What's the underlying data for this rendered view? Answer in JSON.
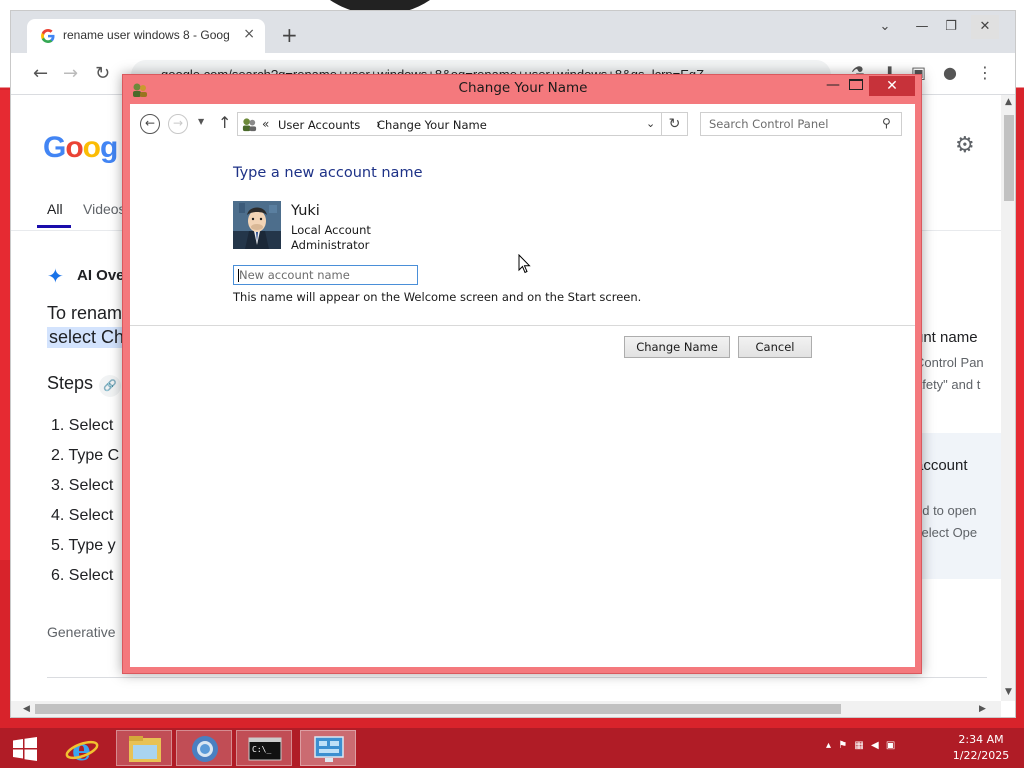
{
  "browser": {
    "tab_title": "rename user windows 8 - Goog",
    "tab_close": "×",
    "new_tab": "+",
    "url": "google.com/search?q=rename+user+windows+8&oq=rename+user+windows+8&gs_lcrp=EgZ"
  },
  "google": {
    "logo": "Goog",
    "tabs": [
      "All",
      "Videos"
    ],
    "ai_overview_title": "AI Ove",
    "answer_lines": [
      "To renam",
      "select Ch"
    ],
    "steps_heading": "Steps",
    "steps": [
      "1.  Select",
      "2.  Type C",
      "3.  Select",
      "4.  Select",
      "5.  Type y",
      "6.  Select"
    ],
    "generative_note": "Generative",
    "side_lines": [
      "unt name",
      "Control Pan",
      "afety\" and t",
      "account",
      "ed to open",
      "select Ope"
    ]
  },
  "dialog": {
    "title": "Change Your Name",
    "breadcrumb": [
      "User Accounts",
      "Change Your Name"
    ],
    "search_placeholder": "Search Control Panel",
    "heading": "Type a new account name",
    "user": {
      "name": "Yuki",
      "account_type": "Local Account",
      "role": "Administrator"
    },
    "input_placeholder": "New account name",
    "input_value": "",
    "hint": "This name will appear on the Welcome screen and on the Start screen.",
    "buttons": {
      "change": "Change Name",
      "cancel": "Cancel"
    }
  },
  "taskbar": {
    "apps": [
      "file-explorer-icon",
      "internet-explorer-icon",
      "chrome-icon",
      "command-prompt-icon",
      "control-panel-icon"
    ],
    "time": "2:34 AM",
    "date": "1/22/2025"
  },
  "colors": {
    "dialog_frame": "#f4797d",
    "dialog_heading": "#1e3287",
    "taskbar": "#b01c26",
    "close_button": "#c7323a"
  }
}
